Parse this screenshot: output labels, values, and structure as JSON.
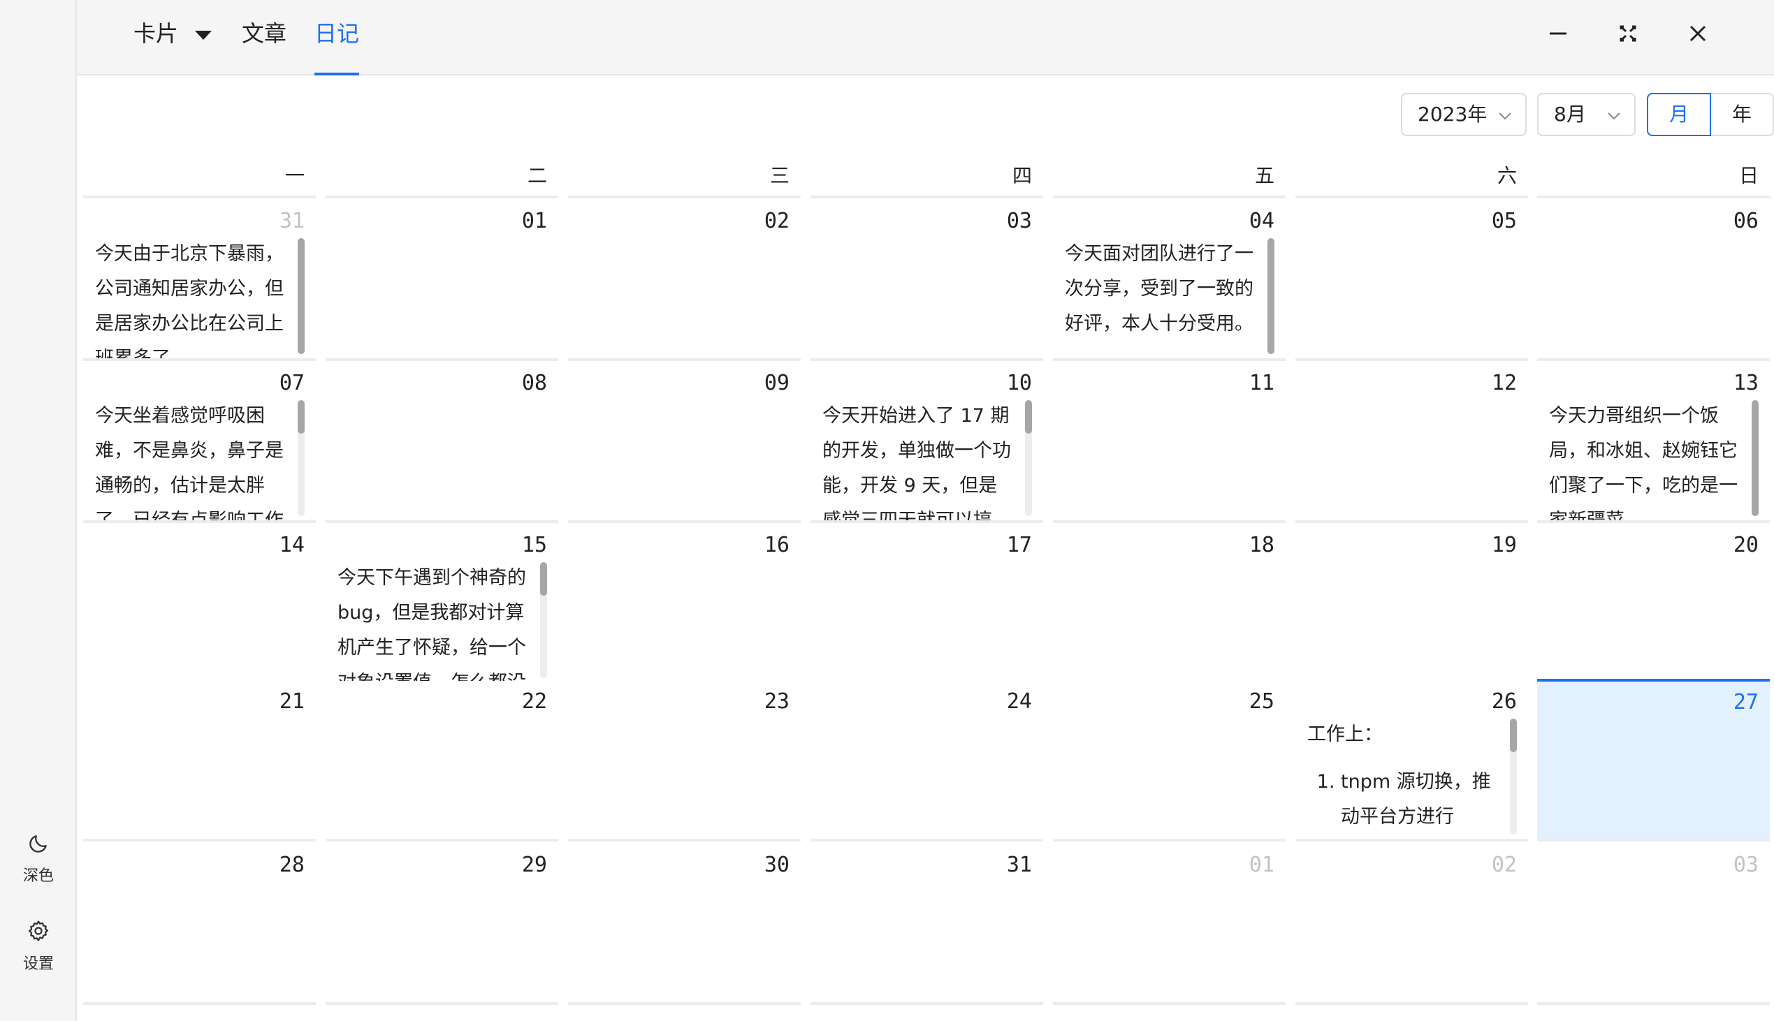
{
  "sidebar": {
    "items": [
      {
        "label": "深色",
        "icon": "moon-icon"
      },
      {
        "label": "设置",
        "icon": "gear-icon"
      }
    ]
  },
  "topbar": {
    "tabs": [
      {
        "label": "卡片",
        "has_dropdown": true,
        "active": false
      },
      {
        "label": "文章",
        "has_dropdown": false,
        "active": false
      },
      {
        "label": "日记",
        "has_dropdown": false,
        "active": true
      }
    ],
    "window_controls": [
      "minimize-icon",
      "fullscreen-icon",
      "close-icon"
    ]
  },
  "toolbar": {
    "year_select": "2023年",
    "month_select": "8月",
    "view_toggle": {
      "month": "月",
      "year": "年",
      "selected": "month"
    }
  },
  "calendar": {
    "weekdays": [
      "一",
      "二",
      "三",
      "四",
      "五",
      "六",
      "日"
    ],
    "today": "27",
    "weeks": [
      [
        {
          "day": "31",
          "other_month": true,
          "note": "今天由于北京下暴雨，公司通知居家办公，但是居家办公比在公司上班累多了"
        },
        {
          "day": "01"
        },
        {
          "day": "02"
        },
        {
          "day": "03"
        },
        {
          "day": "04",
          "note": "今天面对团队进行了一次分享，受到了一致的好评，本人十分受用。"
        },
        {
          "day": "05"
        },
        {
          "day": "06"
        }
      ],
      [
        {
          "day": "07",
          "note": "今天坐着感觉呼吸困难，不是鼻炎，鼻子是通畅的，估计是太胖了，已经有点影响工作"
        },
        {
          "day": "08"
        },
        {
          "day": "09"
        },
        {
          "day": "10",
          "note": "今天开始进入了 17 期的开发，单独做一个功能，开发 9 天，但是感觉三四天就可以搞"
        },
        {
          "day": "11"
        },
        {
          "day": "12"
        },
        {
          "day": "13",
          "note": "今天力哥组织一个饭局，和冰姐、赵婉钰它们聚了一下，吃的是一家新疆菜"
        }
      ],
      [
        {
          "day": "14"
        },
        {
          "day": "15",
          "note": "今天下午遇到个神奇的 bug，但是我都对计算机产生了怀疑，给一个对象设置值，怎么都没"
        },
        {
          "day": "16"
        },
        {
          "day": "17"
        },
        {
          "day": "18"
        },
        {
          "day": "19"
        },
        {
          "day": "20"
        }
      ],
      [
        {
          "day": "21"
        },
        {
          "day": "22"
        },
        {
          "day": "23"
        },
        {
          "day": "24"
        },
        {
          "day": "25"
        },
        {
          "day": "26",
          "note_title": "工作上：",
          "note_list": [
            "tnpm 源切换，推动平台方进行"
          ]
        },
        {
          "day": "27",
          "today": true
        }
      ],
      [
        {
          "day": "28"
        },
        {
          "day": "29"
        },
        {
          "day": "30"
        },
        {
          "day": "31"
        },
        {
          "day": "01",
          "other_month": true
        },
        {
          "day": "02",
          "other_month": true
        },
        {
          "day": "03",
          "other_month": true
        }
      ]
    ]
  },
  "colors": {
    "accent": "#1d6ff2",
    "today_bg": "#e3f0fd",
    "sidebar_bg": "#f5f5f6",
    "other_month_text": "#c2c2c6"
  }
}
